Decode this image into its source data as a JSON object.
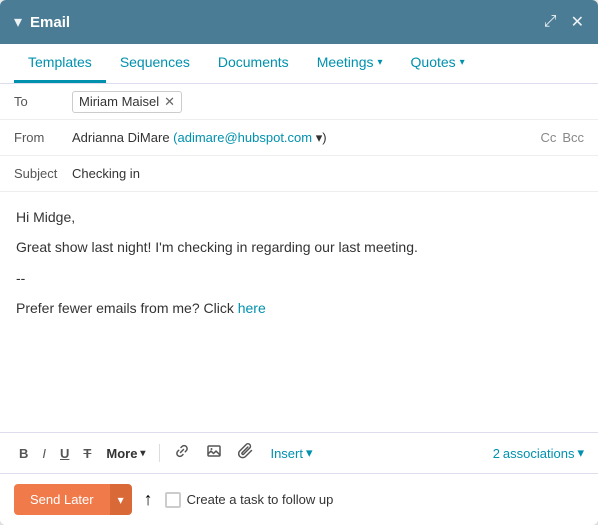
{
  "header": {
    "chevron_label": "▾",
    "title": "Email",
    "expand_icon": "⤢",
    "close_icon": "✕"
  },
  "nav": {
    "tabs": [
      {
        "id": "templates",
        "label": "Templates",
        "active": true,
        "hasDropdown": false
      },
      {
        "id": "sequences",
        "label": "Sequences",
        "hasDropdown": false
      },
      {
        "id": "documents",
        "label": "Documents",
        "hasDropdown": false
      },
      {
        "id": "meetings",
        "label": "Meetings",
        "hasDropdown": true
      },
      {
        "id": "quotes",
        "label": "Quotes",
        "hasDropdown": true
      }
    ]
  },
  "fields": {
    "to_label": "To",
    "to_recipient": "Miriam Maisel",
    "from_label": "From",
    "from_name": "Adrianna DiMare",
    "from_email": "(adimare@hubspot.com",
    "from_email_end": "▾)",
    "cc_label": "Cc",
    "bcc_label": "Bcc",
    "subject_label": "Subject",
    "subject_value": "Checking in"
  },
  "body": {
    "line1": "Hi Midge,",
    "line2": "Great show last night! I'm checking in regarding our last meeting.",
    "line3": "--",
    "line4_prefix": "Prefer fewer emails from me? Click ",
    "line4_link": "here"
  },
  "toolbar": {
    "bold": "B",
    "italic": "I",
    "underline": "U",
    "strikethrough": "T",
    "more_label": "More",
    "link_icon": "⊕",
    "image_icon": "▦",
    "attach_icon": "⊘",
    "insert_label": "Insert",
    "associations_count": "2",
    "associations_label": "associations"
  },
  "bottom": {
    "send_later_label": "Send Later",
    "dropdown_arrow": "▾",
    "task_checkbox_label": "Create a task to follow up"
  }
}
